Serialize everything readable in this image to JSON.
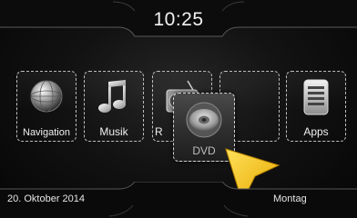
{
  "header": {
    "time": "10:25"
  },
  "apps": [
    {
      "label": "Navigation",
      "icon": "globe-icon"
    },
    {
      "label": "Musik",
      "icon": "music-note-icon"
    },
    {
      "label": "R",
      "icon": "radio-icon"
    },
    {
      "label": "",
      "icon": ""
    },
    {
      "label": "Apps",
      "icon": "apps-list-icon"
    }
  ],
  "drag_item": {
    "label": "DVD",
    "icon": "disc-icon"
  },
  "footer": {
    "date": "20. Oktober 2014",
    "weekday": "Montag"
  },
  "colors": {
    "pointer": "#f6c21a",
    "tile_border": "#bdbdbd",
    "background": "#0a0a0a"
  }
}
